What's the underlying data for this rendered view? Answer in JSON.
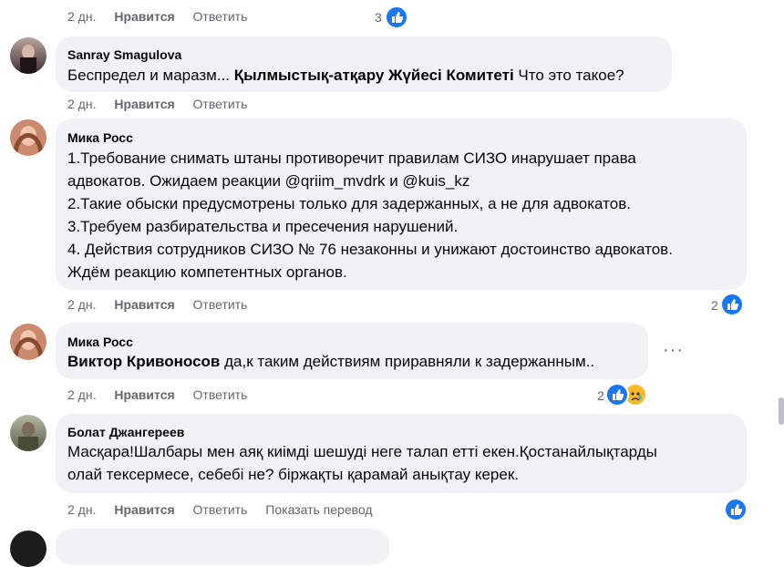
{
  "top_actions": {
    "time": "2 дн.",
    "like": "Нравится",
    "reply": "Ответить",
    "reactions": "3"
  },
  "comments": [
    {
      "author": "Sanray Smagulova",
      "text_parts": {
        "a": "Беспредел и маразм... ",
        "b": "Қылмыстық-атқару Жүйесі Комитеті",
        "c": " Что это такое?"
      },
      "time": "2 дн.",
      "like": "Нравится",
      "reply": "Ответить"
    },
    {
      "author": "Мика Росс",
      "lines": [
        "1.Требование снимать штаны противоречит правилам СИЗО инарушает права",
        "адвокатов. Ожидаем реакции @qriim_mvdrk и @kuis_kz",
        "2.Такие обыски предусмотрены только для задержанных, а не для адвокатов.",
        "3.Требуем разбирательства и пресечения нарушений.",
        "4. Действия сотрудников СИЗО № 76 незаконны и унижают достоинство адвокатов.",
        "Ждём реакцию компетентных органов."
      ],
      "time": "2 дн.",
      "like": "Нравится",
      "reply": "Ответить",
      "reactions": "2"
    },
    {
      "author": "Мика Росс",
      "mention": "Виктор Кривоносов",
      "text": " да,к таким действиям приравняли к задержанным..",
      "time": "2 дн.",
      "like": "Нравится",
      "reply": "Ответить",
      "reactions": "2",
      "more": "···"
    },
    {
      "author": "Болат Джангереев",
      "lines": [
        "Масқара!Шалбары мен аяқ киімді шешуді неге талап етті екен.Қостанайлықтарды",
        "олай тексермесе, себебі не? біржақты қарамай анықтау керек."
      ],
      "time": "2 дн.",
      "like": "Нравится",
      "reply": "Ответить",
      "translate": "Показать перевод"
    }
  ],
  "colors": {
    "like_blue": "#1877f2",
    "bubble": "#f0f2f5",
    "meta": "#65676b"
  }
}
